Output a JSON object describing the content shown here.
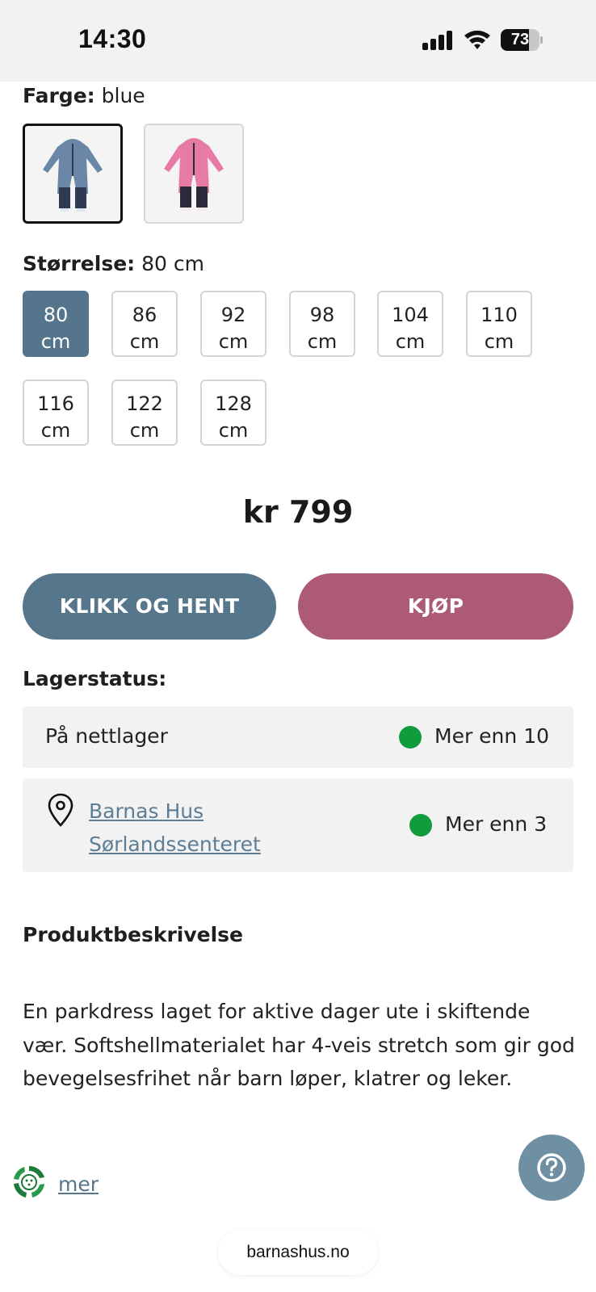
{
  "status_bar": {
    "time": "14:30",
    "battery": "73",
    "battery_level": 0.73
  },
  "color": {
    "label": "Farge:",
    "value": "blue",
    "swatches": [
      {
        "name": "blue",
        "selected": true
      },
      {
        "name": "pink",
        "selected": false
      }
    ]
  },
  "size": {
    "label": "Størrelse:",
    "value": "80 cm",
    "options": [
      {
        "num": "80",
        "unit": "cm",
        "selected": true
      },
      {
        "num": "86",
        "unit": "cm"
      },
      {
        "num": "92",
        "unit": "cm"
      },
      {
        "num": "98",
        "unit": "cm"
      },
      {
        "num": "104",
        "unit": "cm"
      },
      {
        "num": "110",
        "unit": "cm"
      },
      {
        "num": "116",
        "unit": "cm"
      },
      {
        "num": "122",
        "unit": "cm"
      },
      {
        "num": "128",
        "unit": "cm"
      }
    ]
  },
  "price": "kr 799",
  "buttons": {
    "pickup": "KLIKK OG HENT",
    "buy": "KJØP"
  },
  "stock": {
    "title": "Lagerstatus:",
    "online": {
      "label": "På nettlager",
      "status": "Mer enn 10"
    },
    "store": {
      "name_line1": "Barnas Hus",
      "name_line2": "Sørlandssenteret",
      "status": "Mer enn 3"
    }
  },
  "description": {
    "title": "Produktbeskrivelse",
    "text": "En parkdress laget for aktive dager ute i skiftende vær. Softshellmaterialet har 4-veis stretch som gir god bevegelsesfrihet når barn løper, klatrer og leker."
  },
  "more_link": "mer",
  "url": "barnashus.no",
  "colors": {
    "accent_blue": "#56768b",
    "accent_pink": "#ad5a76",
    "in_stock_green": "#109b3d"
  }
}
